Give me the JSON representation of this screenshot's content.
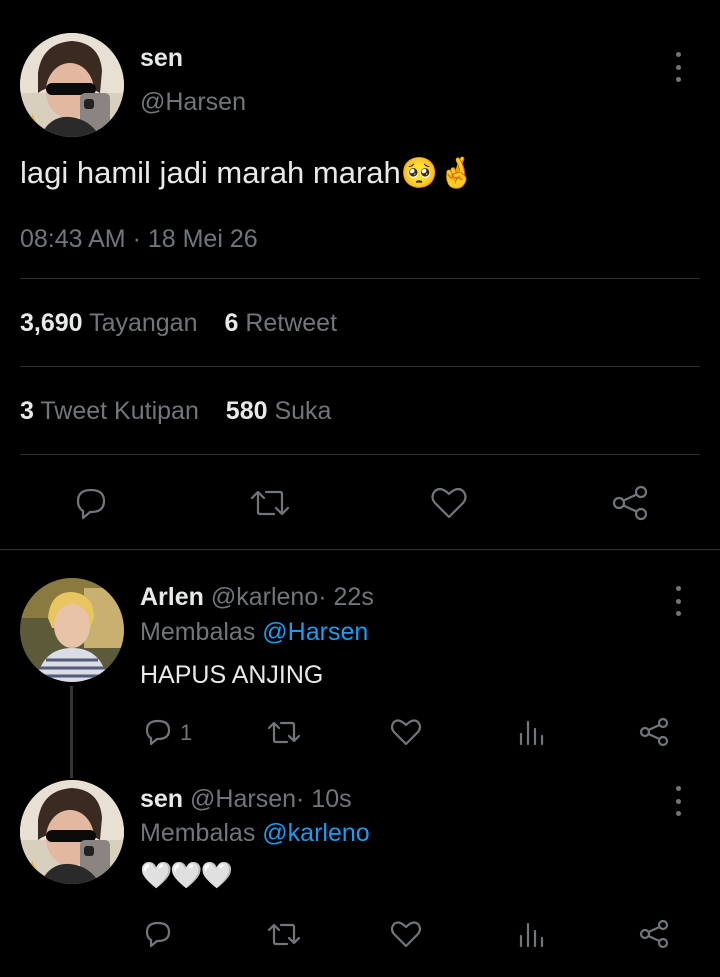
{
  "main_tweet": {
    "author_name": "sen",
    "author_handle": "@Harsen",
    "text": "lagi hamil jadi marah marah",
    "emoji": "🥺🤞",
    "timestamp": "08:43 AM · 18 Mei 26",
    "stats": {
      "views_count": "3,690",
      "views_label": "Tayangan",
      "retweets_count": "6",
      "retweets_label": "Retweet",
      "quotes_count": "3",
      "quotes_label": "Tweet Kutipan",
      "likes_count": "580",
      "likes_label": "Suka"
    },
    "actions": [
      "reply-icon",
      "retweet-icon",
      "like-icon",
      "share-icon"
    ]
  },
  "replies": [
    {
      "name": "Arlen",
      "handle": "@karleno",
      "time": "· 22s",
      "replying_prefix": "Membalas",
      "replying_to": "@Harsen",
      "text": "HAPUS ANJING",
      "reply_count": "1"
    },
    {
      "name": "sen",
      "handle": "@Harsen",
      "time": "· 10s",
      "replying_prefix": "Membalas",
      "replying_to": "@karleno",
      "text": "🤍🤍🤍",
      "reply_count": ""
    }
  ],
  "colors": {
    "background": "#000000",
    "text": "#e7e9ea",
    "muted": "#71767b",
    "link": "#1d9bf0",
    "divider": "#2f3336"
  }
}
